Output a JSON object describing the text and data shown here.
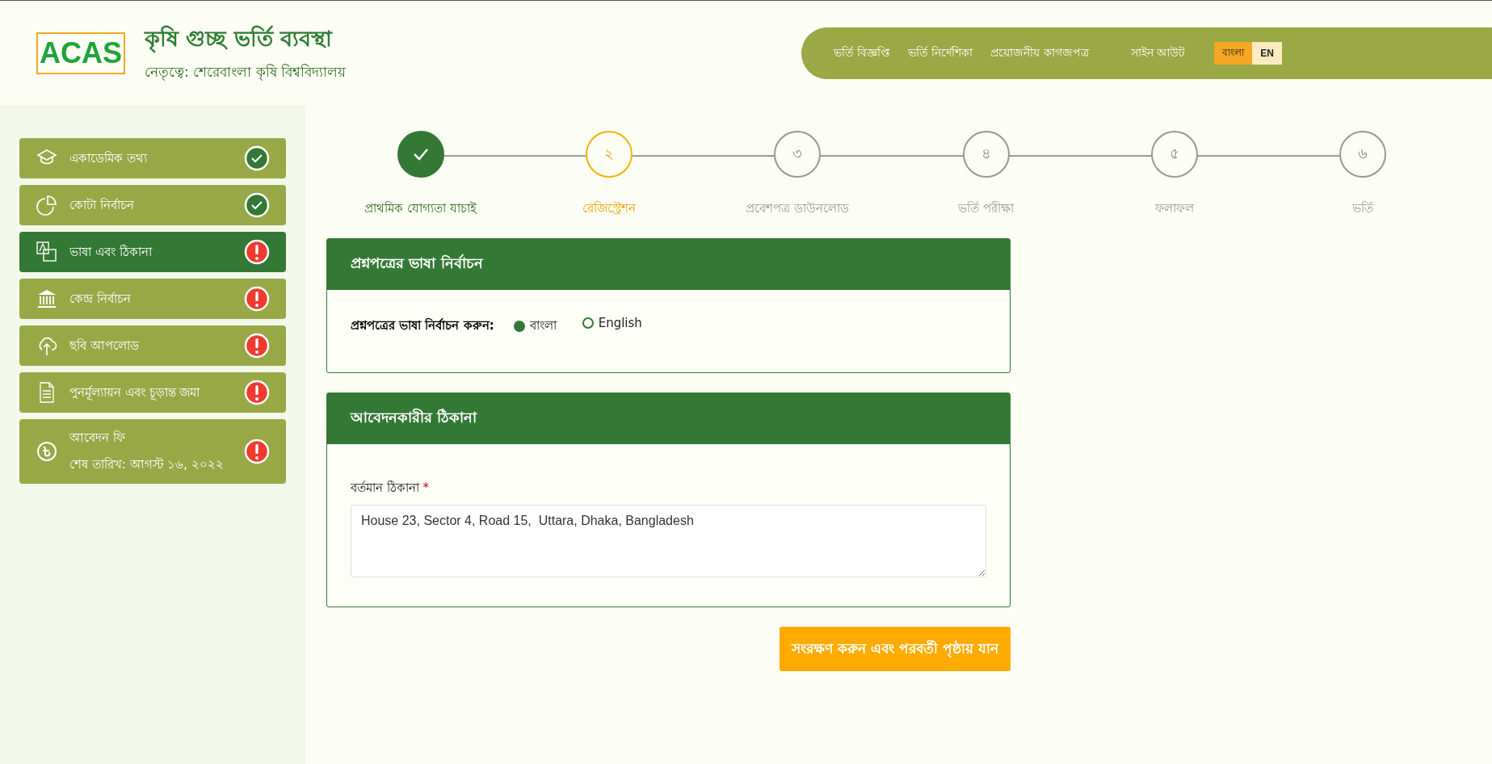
{
  "header": {
    "logo": "ACAS",
    "title": "কৃষি গুচ্ছ ভর্তি ব্যবস্থা",
    "subtitle": "নেতৃত্বে: শেরেবাংলা কৃষি বিশ্ববিদ্যালয়",
    "nav": [
      "ভর্তি বিজ্ঞপ্তি",
      "ভর্তি নির্দেশিকা",
      "প্রয়োজনীয় কাগজপত্র",
      "সাইন আউট"
    ],
    "languages": [
      {
        "label": "বাংলা",
        "selected": true
      },
      {
        "label": "EN",
        "selected": false
      }
    ]
  },
  "sidebar": {
    "items": [
      {
        "kind": "cap",
        "label": "একাডেমিক তথ্য",
        "complete": true,
        "selected": false
      },
      {
        "kind": "pie",
        "label": "কোটা নির্বাচন",
        "complete": true,
        "selected": false
      },
      {
        "kind": "translate",
        "label": "ভাষা এবং ঠিকানা",
        "complete": false,
        "selected": true
      },
      {
        "kind": "bank",
        "label": "কেন্দ্র নির্বাচন",
        "complete": false,
        "selected": false
      },
      {
        "kind": "upload",
        "label": "ছবি আপলোড",
        "complete": false,
        "selected": false
      },
      {
        "kind": "doc",
        "label": "পুনর্মূল্যায়ন এবং চূড়ান্ত জমা",
        "complete": false,
        "selected": false
      },
      {
        "kind": "taka",
        "label": "আবেদন ফি",
        "sublabel": "শেষ তারিখ: আগস্ট ১৬, ২০২২",
        "complete": false,
        "selected": false
      }
    ]
  },
  "stepper": [
    {
      "label": "প্রাথমিক যোগ্যতা যাচাই",
      "done": true,
      "current": false
    },
    {
      "number": "২",
      "label": "রেজিস্ট্রেশন",
      "done": false,
      "current": true
    },
    {
      "number": "৩",
      "label": "প্রবেশপত্র ডাউনলোড",
      "done": false,
      "current": false
    },
    {
      "number": "৪",
      "label": "ভর্তি পরীক্ষা",
      "done": false,
      "current": false
    },
    {
      "number": "৫",
      "label": "ফলাফল",
      "done": false,
      "current": false
    },
    {
      "number": "৬",
      "label": "ভর্তি",
      "done": false,
      "current": false
    }
  ],
  "language_panel": {
    "title": "প্রশ্নপত্রের ভাষা নির্বাচন",
    "question": "প্রশ্নপত্রের ভাষা নির্বাচন করুন:",
    "options": [
      {
        "label": "বাংলা",
        "selected": true
      },
      {
        "label": "English",
        "selected": false
      }
    ]
  },
  "address_panel": {
    "title": "আবেদনকারীর ঠিকানা",
    "field_label": "বর্তমান ঠিকানা",
    "required_mark": "*",
    "value": "House 23, Sector 4, Road 15,  Uttara, Dhaka, Bangladesh"
  },
  "submit_button": "সংরক্ষণ করুন এবং পরবর্তী পৃষ্ঠায় যান"
}
